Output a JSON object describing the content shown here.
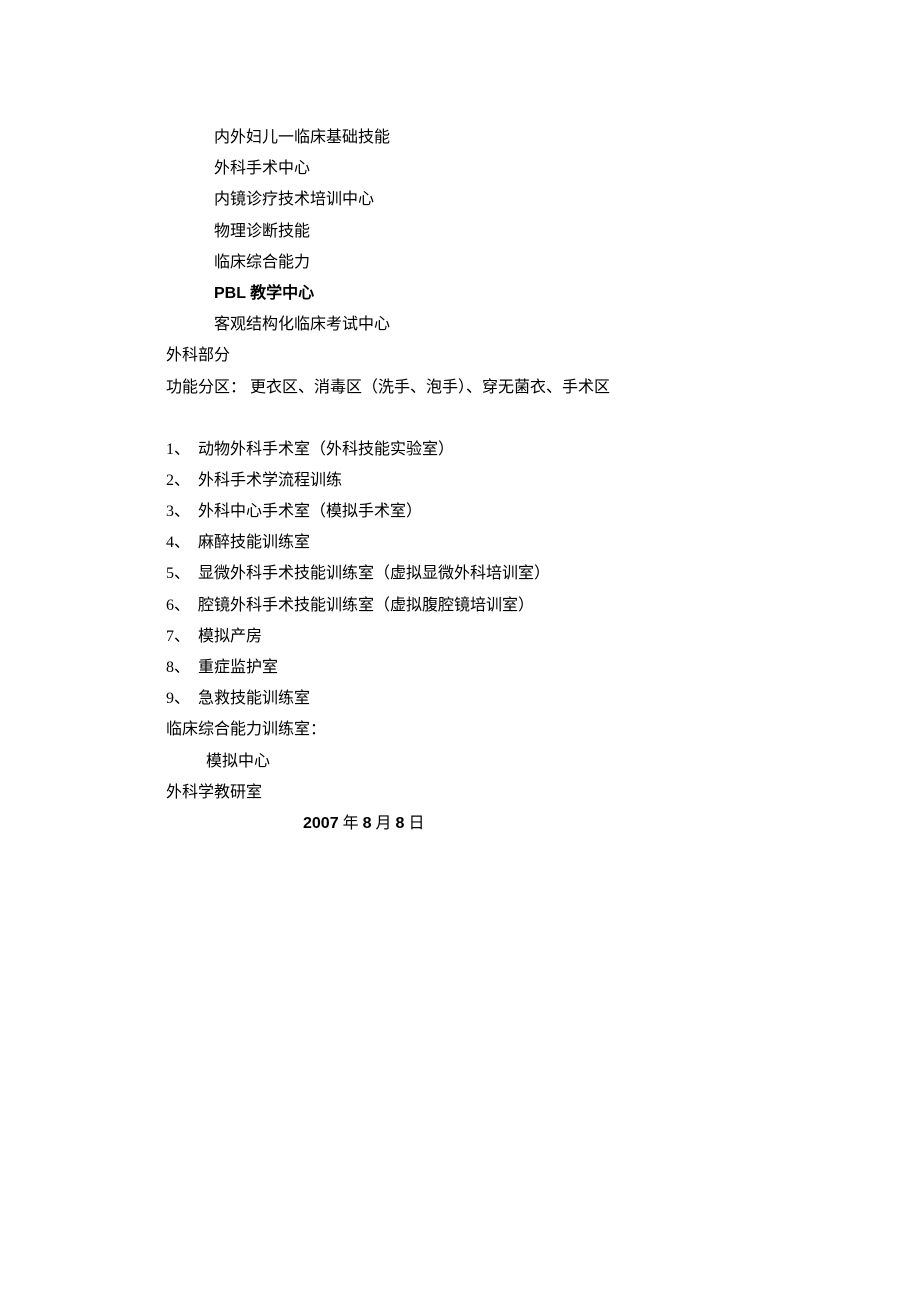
{
  "centers": [
    "内外妇儿一临床基础技能",
    "外科手术中心",
    "内镜诊疗技术培训中心",
    "物理诊断技能",
    "临床综合能力",
    "PBL 教学中心",
    "客观结构化临床考试中心"
  ],
  "section1_label": "外科部分",
  "section2_label": "功能分区：",
  "section2_content": "更衣区、消毒区（洗手、泡手）、穿无菌衣、手术区",
  "numbered_items": [
    {
      "num": "1、",
      "text": "动物外科手术室（外科技能实验室）"
    },
    {
      "num": "2、",
      "text": "外科手术学流程训练"
    },
    {
      "num": "3、",
      "text": "外科中心手术室（模拟手术室）"
    },
    {
      "num": "4、",
      "text": "麻醉技能训练室"
    },
    {
      "num": "5、",
      "text": "显微外科手术技能训练室（虚拟显微外科培训室）"
    },
    {
      "num": "6、",
      "text": "腔镜外科手术技能训练室（虚拟腹腔镜培训室）"
    },
    {
      "num": "7、",
      "text": "模拟产房"
    },
    {
      "num": "8、",
      "text": "重症监护室"
    },
    {
      "num": "9、",
      "text": "急救技能训练室"
    }
  ],
  "clinical_label": "临床综合能力训练室：",
  "simulation_center": "模拟中心",
  "surgery_dept": "外科学教研室",
  "date_parts": {
    "year": "2007",
    "year_suffix": " 年 ",
    "month": "8",
    "month_suffix": " 月 ",
    "day": "8",
    "day_suffix": " 日"
  }
}
